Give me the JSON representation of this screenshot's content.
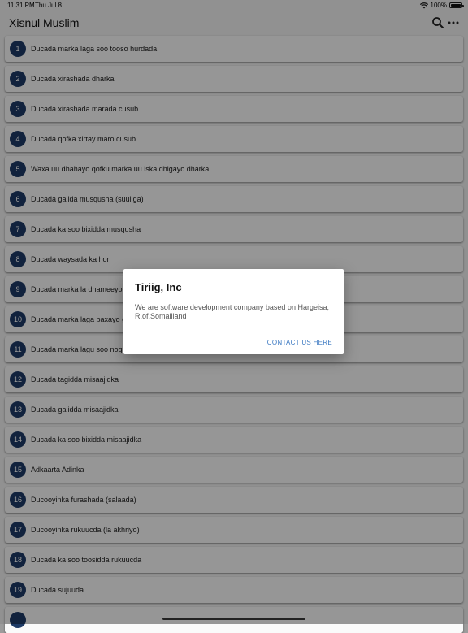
{
  "status": {
    "time": "11:31 PM",
    "date": "Thu Jul 8",
    "battery": "100%",
    "battery_level": 1.0
  },
  "appbar": {
    "title": "Xisnul Muslim",
    "search_icon": "search-icon",
    "more_icon": "more-horizontal-icon"
  },
  "colors": {
    "badge": "#1d3a66",
    "accent": "#3a78c2"
  },
  "items": [
    {
      "num": "1",
      "label": "Ducada marka laga soo tooso hurdada"
    },
    {
      "num": "2",
      "label": "Ducada xirashada dharka"
    },
    {
      "num": "3",
      "label": "Ducada xirashada marada cusub"
    },
    {
      "num": "4",
      "label": "Ducada qofka xirtay maro cusub"
    },
    {
      "num": "5",
      "label": "Waxa uu dhahayo qofku marka uu iska dhigayo dharka"
    },
    {
      "num": "6",
      "label": "Ducada galida musqusha (suuliga)"
    },
    {
      "num": "7",
      "label": "Ducada ka soo bixidda musqusha"
    },
    {
      "num": "8",
      "label": "Ducada waysada ka hor"
    },
    {
      "num": "9",
      "label": "Ducada marka la dhameeyo"
    },
    {
      "num": "10",
      "label": "Ducada marka laga baxayo g"
    },
    {
      "num": "11",
      "label": "Ducada marka lagu soo noqo"
    },
    {
      "num": "12",
      "label": "Ducada tagidda misaajidka"
    },
    {
      "num": "13",
      "label": "Ducada galidda misaajidka"
    },
    {
      "num": "14",
      "label": "Ducada ka soo bixidda misaajidka"
    },
    {
      "num": "15",
      "label": "Adkaarta Adinka"
    },
    {
      "num": "16",
      "label": "Ducooyinka furashada (salaada)"
    },
    {
      "num": "17",
      "label": "Ducooyinka rukuucda (la akhriyo)"
    },
    {
      "num": "18",
      "label": "Ducada ka soo toosidda rukuucda"
    },
    {
      "num": "19",
      "label": "Ducada sujuuda"
    },
    {
      "num": "",
      "label": ""
    }
  ],
  "dialog": {
    "title": "Tiriig, Inc",
    "body": "We are software development company based on Hargeisa, R.of.Somaliland",
    "action": "CONTACT US HERE"
  }
}
